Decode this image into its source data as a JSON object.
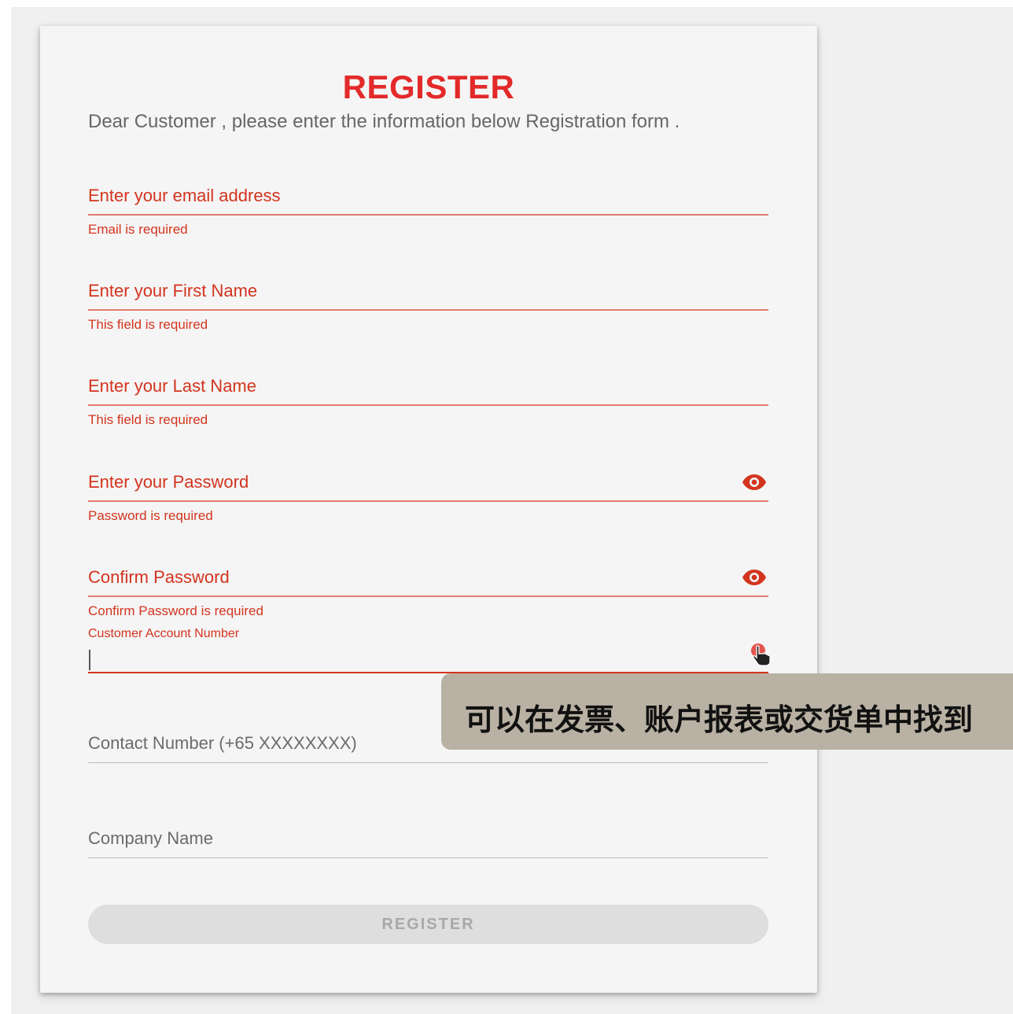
{
  "form": {
    "title": "REGISTER",
    "intro": "Dear Customer , please enter the information below Registration form .",
    "email": {
      "label": "Enter your email address",
      "error": "Email is required"
    },
    "first_name": {
      "label": "Enter your First Name",
      "error": "This field is required"
    },
    "last_name": {
      "label": "Enter your Last Name",
      "error": "This field is required"
    },
    "password": {
      "label": "Enter your Password",
      "error": "Password is required"
    },
    "confirm_password": {
      "label": "Confirm Password",
      "error": "Confirm Password is required"
    },
    "account_number": {
      "label": "Customer Account Number",
      "value": ""
    },
    "contact_number": {
      "label": "Contact Number (+65 XXXXXXXX)"
    },
    "company_name": {
      "label": "Company Name"
    },
    "submit_label": "REGISTER"
  },
  "tooltip": {
    "text": "可以在发票、账户报表或交货单中找到"
  },
  "colors": {
    "accent": "#e32a2a",
    "error": "#d3341e",
    "tooltip_bg": "#b9b1a3",
    "button_disabled": "#dedede"
  },
  "icons": {
    "password_toggle": "eye-icon",
    "confirm_toggle": "eye-icon",
    "pointer": "hand-pointer-icon"
  }
}
